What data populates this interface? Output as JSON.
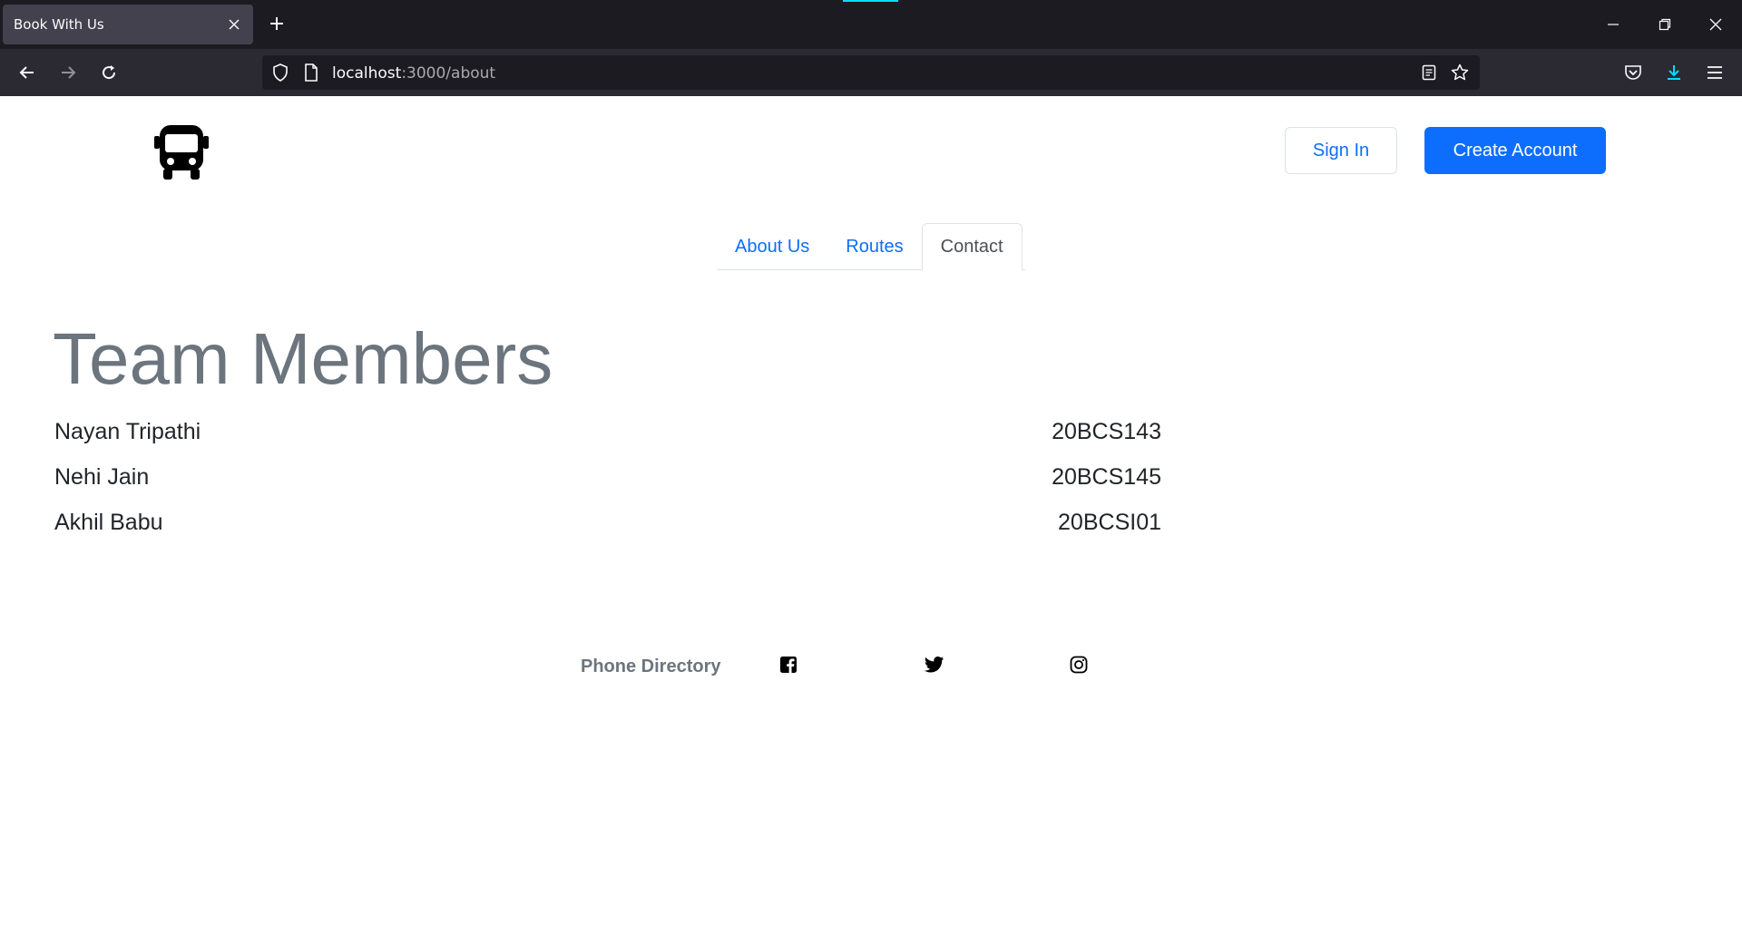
{
  "browser": {
    "tab_title": "Book With Us",
    "url_host": "localhost",
    "url_path": ":3000/about"
  },
  "header": {
    "logo_icon": "bus-icon",
    "sign_in_label": "Sign In",
    "create_account_label": "Create Account"
  },
  "nav": {
    "tabs": [
      {
        "label": "About Us",
        "active": false
      },
      {
        "label": "Routes",
        "active": false
      },
      {
        "label": "Contact",
        "active": true
      }
    ]
  },
  "main": {
    "heading": "Team Members",
    "members": [
      {
        "name": "Nayan Tripathi",
        "id": "20BCS143"
      },
      {
        "name": "Nehi Jain",
        "id": "20BCS145"
      },
      {
        "name": "Akhil Babu",
        "id": "20BCSI01"
      }
    ]
  },
  "footer": {
    "title": "Phone Directory",
    "social_icons": [
      "facebook-icon",
      "twitter-icon",
      "instagram-icon"
    ]
  },
  "colors": {
    "primary": "#0d6efd",
    "muted": "#6c757d",
    "chrome_dark": "#1c1b22"
  }
}
